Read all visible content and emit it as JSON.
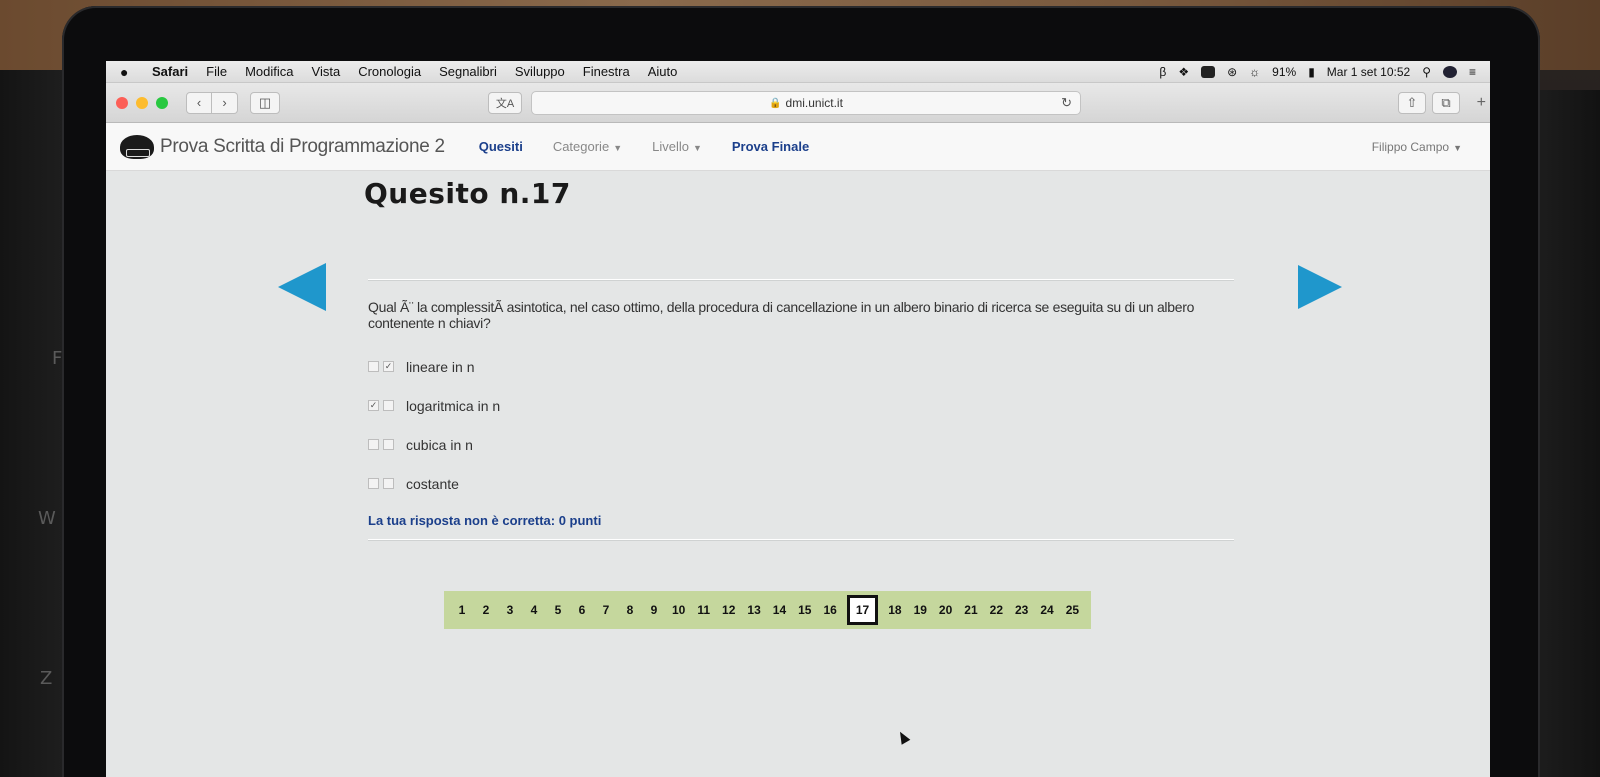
{
  "menubar": {
    "items": [
      "Safari",
      "File",
      "Modifica",
      "Vista",
      "Cronologia",
      "Segnalibri",
      "Sviluppo",
      "Finestra",
      "Aiuto"
    ],
    "battery": "91%",
    "datetime": "Mar 1 set  10:52"
  },
  "toolbar": {
    "translate_label": "文A",
    "url": "dmi.unict.it"
  },
  "site": {
    "brand": "Prova Scritta di Programmazione 2",
    "nav": {
      "quesiti": "Quesiti",
      "categorie": "Categorie",
      "livello": "Livello",
      "prova_finale": "Prova Finale"
    },
    "user": "Filippo Campo"
  },
  "quiz": {
    "title": "Quesito n.17",
    "question": "Qual Ã¨ la complessitÃ  asintotica, nel caso ottimo, della procedura di cancellazione in un albero binario di ricerca se eseguita su di un albero contenente n chiavi?",
    "answers": [
      {
        "label": "lineare in n",
        "mark1": "",
        "mark2": "✓"
      },
      {
        "label": "logaritmica in n",
        "mark1": "✓",
        "mark2": ""
      },
      {
        "label": "cubica in n",
        "mark1": "",
        "mark2": ""
      },
      {
        "label": "costante",
        "mark1": "",
        "mark2": ""
      }
    ],
    "result": "La tua risposta non è corretta: 0 punti"
  },
  "pager": {
    "pages": [
      "1",
      "2",
      "3",
      "4",
      "5",
      "6",
      "7",
      "8",
      "9",
      "10",
      "11",
      "12",
      "13",
      "14",
      "15",
      "16",
      "17",
      "18",
      "19",
      "20",
      "21",
      "22",
      "23",
      "24",
      "25"
    ],
    "current": "17"
  },
  "colors": {
    "arrow": "#1f97cc",
    "pager_bg": "#c5d79d",
    "accent_text": "#1b3f8b"
  }
}
